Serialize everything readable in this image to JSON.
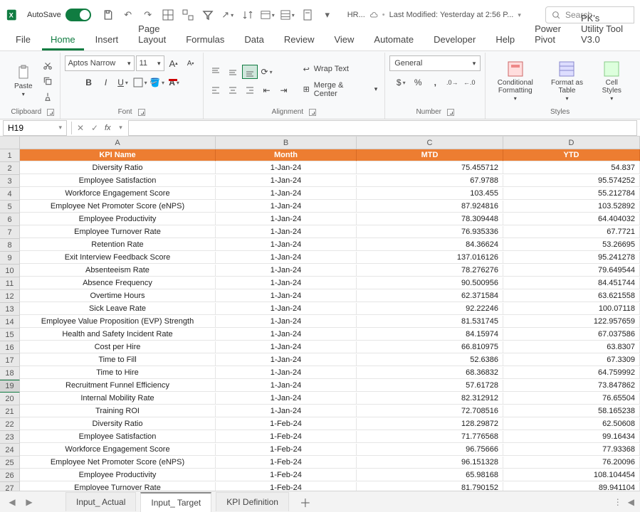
{
  "titlebar": {
    "autosave_label": "AutoSave",
    "doc_name": "HR...",
    "saved_sep": "•",
    "saved_text": "Last Modified: Yesterday at 2:56 P...",
    "search_placeholder": "Search"
  },
  "tabs": {
    "file": "File",
    "home": "Home",
    "insert": "Insert",
    "page_layout": "Page Layout",
    "formulas": "Formulas",
    "data": "Data",
    "review": "Review",
    "view": "View",
    "automate": "Automate",
    "developer": "Developer",
    "help": "Help",
    "power_pivot": "Power Pivot",
    "utility": "PK's Utility Tool V3.0"
  },
  "ribbon": {
    "clipboard": {
      "paste": "Paste",
      "label": "Clipboard"
    },
    "font": {
      "name": "Aptos Narrow",
      "size": "11",
      "label": "Font"
    },
    "alignment": {
      "wrap": "Wrap Text",
      "merge": "Merge & Center",
      "label": "Alignment"
    },
    "number": {
      "format": "General",
      "label": "Number"
    },
    "styles": {
      "cond": "Conditional Formatting",
      "table": "Format as Table",
      "cell": "Cell Styles",
      "label": "Styles"
    }
  },
  "namebox": "H19",
  "columns": [
    "A",
    "B",
    "C",
    "D"
  ],
  "headers": {
    "a": "KPI Name",
    "b": "Month",
    "c": "MTD",
    "d": "YTD"
  },
  "rows": [
    {
      "n": "1"
    },
    {
      "n": "2",
      "a": "Diversity Ratio",
      "b": "1-Jan-24",
      "c": "75.455712",
      "d": "54.837"
    },
    {
      "n": "3",
      "a": "Employee Satisfaction",
      "b": "1-Jan-24",
      "c": "67.9788",
      "d": "95.574252"
    },
    {
      "n": "4",
      "a": "Workforce Engagement Score",
      "b": "1-Jan-24",
      "c": "103.455",
      "d": "55.212784"
    },
    {
      "n": "5",
      "a": "Employee Net Promoter Score (eNPS)",
      "b": "1-Jan-24",
      "c": "87.924816",
      "d": "103.52892"
    },
    {
      "n": "6",
      "a": "Employee Productivity",
      "b": "1-Jan-24",
      "c": "78.309448",
      "d": "64.404032"
    },
    {
      "n": "7",
      "a": "Employee Turnover Rate",
      "b": "1-Jan-24",
      "c": "76.935336",
      "d": "67.7721"
    },
    {
      "n": "8",
      "a": "Retention Rate",
      "b": "1-Jan-24",
      "c": "84.36624",
      "d": "53.26695"
    },
    {
      "n": "9",
      "a": "Exit Interview Feedback Score",
      "b": "1-Jan-24",
      "c": "137.016126",
      "d": "95.241278"
    },
    {
      "n": "10",
      "a": "Absenteeism Rate",
      "b": "1-Jan-24",
      "c": "78.276276",
      "d": "79.649544"
    },
    {
      "n": "11",
      "a": "Absence Frequency",
      "b": "1-Jan-24",
      "c": "90.500956",
      "d": "84.451744"
    },
    {
      "n": "12",
      "a": "Overtime Hours",
      "b": "1-Jan-24",
      "c": "62.371584",
      "d": "63.621558"
    },
    {
      "n": "13",
      "a": "Sick Leave Rate",
      "b": "1-Jan-24",
      "c": "92.22246",
      "d": "100.07118"
    },
    {
      "n": "14",
      "a": "Employee Value Proposition (EVP) Strength",
      "b": "1-Jan-24",
      "c": "81.531745",
      "d": "122.957659"
    },
    {
      "n": "15",
      "a": "Health and Safety Incident Rate",
      "b": "1-Jan-24",
      "c": "84.15974",
      "d": "67.037586"
    },
    {
      "n": "16",
      "a": "Cost per Hire",
      "b": "1-Jan-24",
      "c": "66.810975",
      "d": "63.8307"
    },
    {
      "n": "17",
      "a": "Time to Fill",
      "b": "1-Jan-24",
      "c": "52.6386",
      "d": "67.3309"
    },
    {
      "n": "18",
      "a": "Time to Hire",
      "b": "1-Jan-24",
      "c": "68.36832",
      "d": "64.759992"
    },
    {
      "n": "19",
      "a": "Recruitment Funnel Efficiency",
      "b": "1-Jan-24",
      "c": "57.61728",
      "d": "73.847862"
    },
    {
      "n": "20",
      "a": "Internal Mobility Rate",
      "b": "1-Jan-24",
      "c": "82.312912",
      "d": "76.65504"
    },
    {
      "n": "21",
      "a": "Training ROI",
      "b": "1-Jan-24",
      "c": "72.708516",
      "d": "58.165238"
    },
    {
      "n": "22",
      "a": "Diversity Ratio",
      "b": "1-Feb-24",
      "c": "128.29872",
      "d": "62.50608"
    },
    {
      "n": "23",
      "a": "Employee Satisfaction",
      "b": "1-Feb-24",
      "c": "71.776568",
      "d": "99.16434"
    },
    {
      "n": "24",
      "a": "Workforce Engagement Score",
      "b": "1-Feb-24",
      "c": "96.75666",
      "d": "77.93368"
    },
    {
      "n": "25",
      "a": "Employee Net Promoter Score (eNPS)",
      "b": "1-Feb-24",
      "c": "96.151328",
      "d": "76.20096"
    },
    {
      "n": "26",
      "a": "Employee Productivity",
      "b": "1-Feb-24",
      "c": "65.98168",
      "d": "108.104454"
    },
    {
      "n": "27",
      "a": "Employee Turnover Rate",
      "b": "1-Feb-24",
      "c": "81.790152",
      "d": "89.941104"
    }
  ],
  "sheets": {
    "s1": "Input_ Actual",
    "s2": "Input_ Target",
    "s3": "KPI Definition"
  }
}
